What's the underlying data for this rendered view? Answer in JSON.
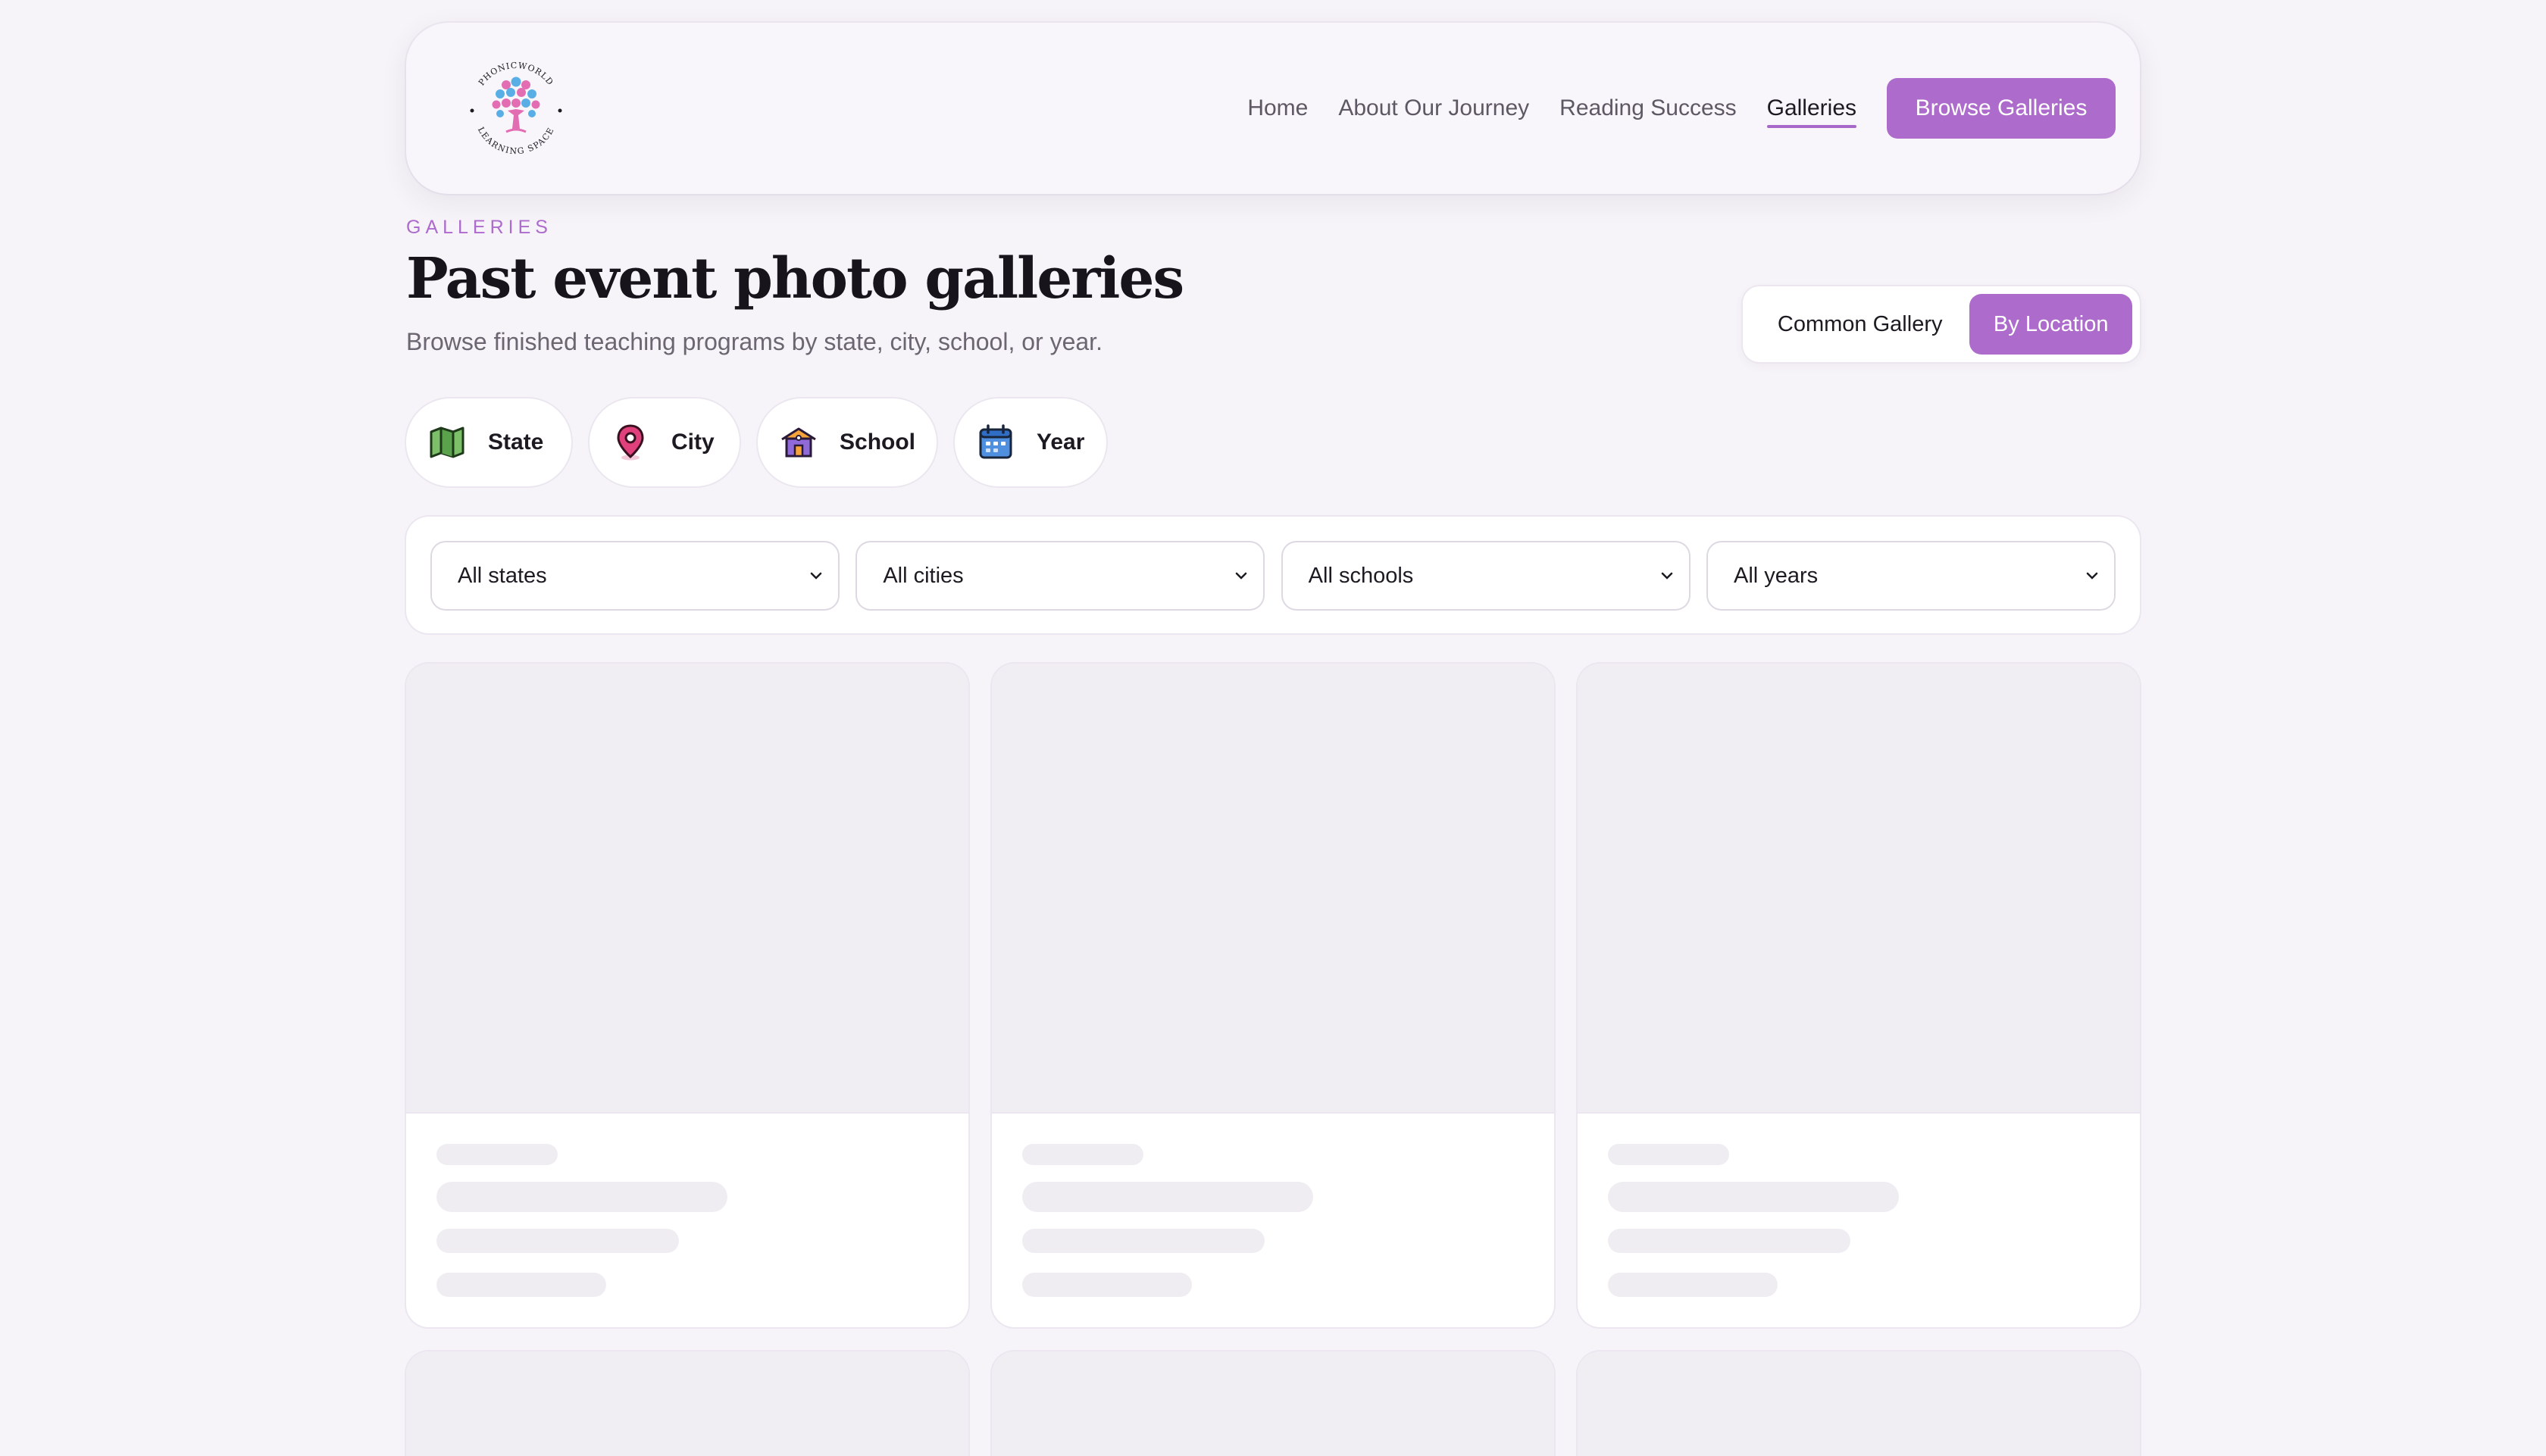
{
  "header": {
    "logo": {
      "icon": "tree-of-hearts-logo",
      "top_text": "PHONICWORLD",
      "bottom_text": "LEARNING SPACE"
    },
    "nav": [
      {
        "label": "Home",
        "active": false
      },
      {
        "label": "About Our Journey",
        "active": false
      },
      {
        "label": "Reading Success",
        "active": false
      },
      {
        "label": "Galleries",
        "active": true
      }
    ],
    "cta_label": "Browse Galleries"
  },
  "intro": {
    "eyebrow": "GALLERIES",
    "title": "Past event photo galleries",
    "subtitle": "Browse finished teaching programs by state, city, school, or year."
  },
  "view_toggle": {
    "options": [
      "Common Gallery",
      "By Location"
    ],
    "selected": "By Location"
  },
  "filter_chips": [
    {
      "label": "State",
      "icon": "map-icon"
    },
    {
      "label": "City",
      "icon": "map-pin-icon"
    },
    {
      "label": "School",
      "icon": "school-house-icon"
    },
    {
      "label": "Year",
      "icon": "calendar-icon"
    }
  ],
  "filters": {
    "state": "All states",
    "city": "All cities",
    "school": "All schools",
    "year": "All years"
  },
  "gallery_cards": {
    "state": "loading-skeleton"
  },
  "colors": {
    "accent": "#ad6bcc",
    "background": "#f6f4f8",
    "skeleton": "#efedf1"
  }
}
